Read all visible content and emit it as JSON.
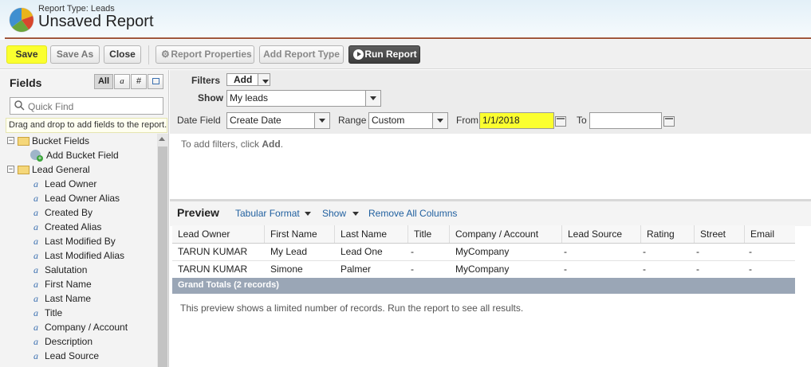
{
  "header": {
    "report_type": "Report Type: Leads",
    "title": "Unsaved Report"
  },
  "toolbar": {
    "save": "Save",
    "save_as": "Save As",
    "close": "Close",
    "report_properties": "Report Properties",
    "add_report_type": "Add Report Type",
    "run_report": "Run Report"
  },
  "sidebar": {
    "title": "Fields",
    "field_type_filters": [
      "All",
      "a",
      "#",
      "calendar"
    ],
    "quick_find_placeholder": "Quick Find",
    "tooltip": "Drag and drop to add fields to the report.",
    "groups": [
      {
        "label": "Bucket Fields",
        "items": [
          "Add Bucket Field"
        ]
      },
      {
        "label": "Lead General",
        "items": [
          "Lead Owner",
          "Lead Owner Alias",
          "Created By",
          "Created Alias",
          "Last Modified By",
          "Last Modified Alias",
          "Salutation",
          "First Name",
          "Last Name",
          "Title",
          "Company / Account",
          "Description",
          "Lead Source"
        ]
      }
    ]
  },
  "filters": {
    "label": "Filters",
    "add": "Add",
    "show_label": "Show",
    "show_value": "My leads",
    "date_field_label": "Date Field",
    "date_field_value": "Create Date",
    "range_label": "Range",
    "range_value": "Custom",
    "from_label": "From",
    "from_value": "1/1/2018",
    "to_label": "To",
    "to_value": "",
    "hint_prefix": "To add filters, click ",
    "hint_link": "Add",
    "hint_suffix": "."
  },
  "preview": {
    "title": "Preview",
    "format": "Tabular Format",
    "show": "Show",
    "remove_all_columns": "Remove All Columns",
    "columns": [
      "Lead Owner",
      "First Name",
      "Last Name",
      "Title",
      "Company / Account",
      "Lead Source",
      "Rating",
      "Street",
      "Email"
    ],
    "rows": [
      [
        "TARUN KUMAR",
        "My Lead",
        "Lead One",
        "-",
        "MyCompany",
        "-",
        "-",
        "-",
        "-"
      ],
      [
        "TARUN KUMAR",
        "Simone",
        "Palmer",
        "-",
        "MyCompany",
        "-",
        "-",
        "-",
        "-"
      ]
    ],
    "grand_totals": "Grand Totals (2 records)",
    "note": "This preview shows a limited number of records. Run the report to see all results."
  },
  "colors": {
    "highlight": "#fbff2f",
    "header_rule": "#a0583d",
    "link": "#1f5f9f",
    "totals_bar": "#9aa6b6"
  }
}
